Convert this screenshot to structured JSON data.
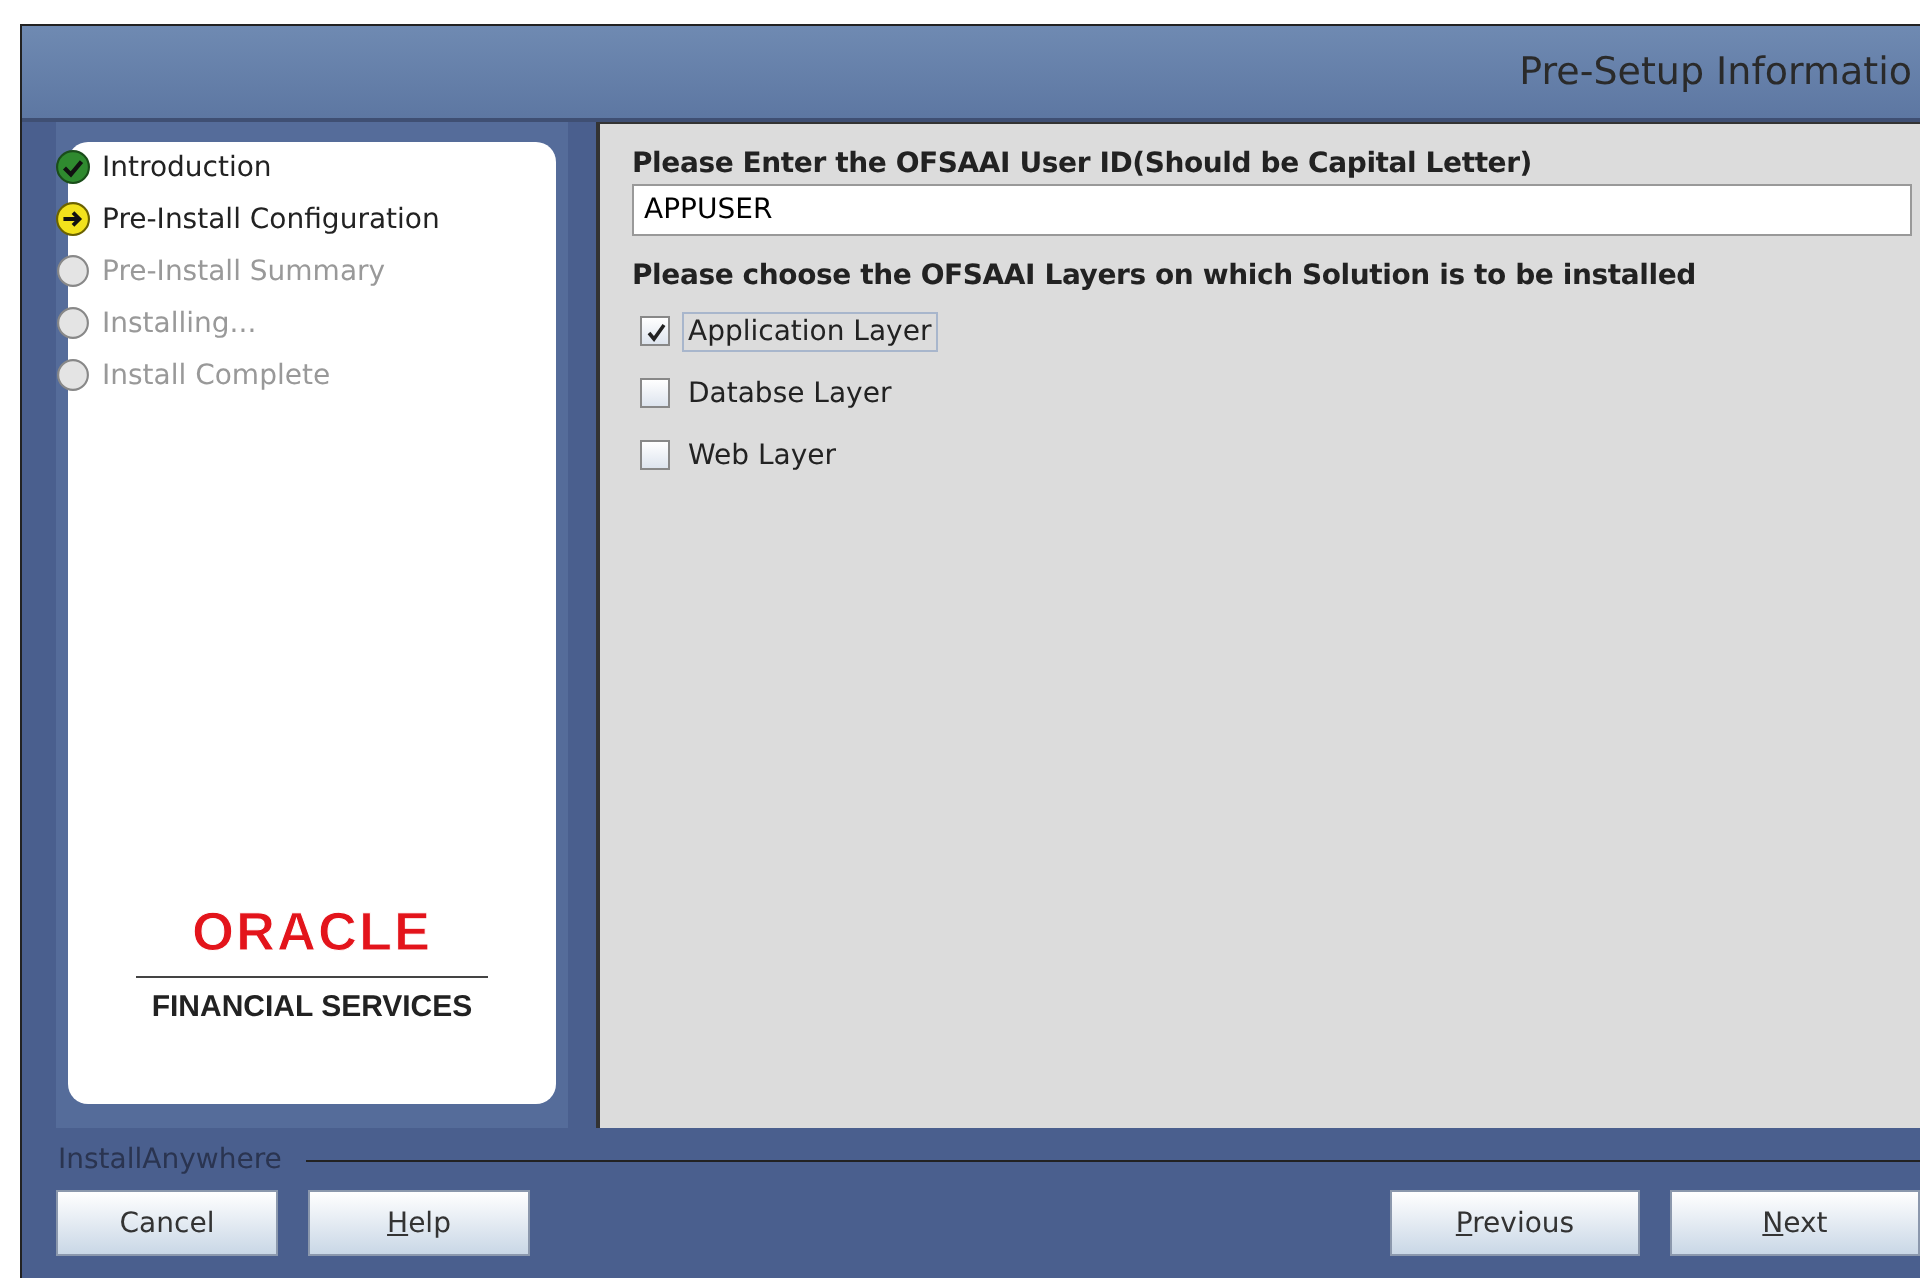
{
  "window": {
    "title": "Pre-Setup Informatio"
  },
  "steps": [
    {
      "label": "Introduction",
      "kind": "done"
    },
    {
      "label": "Pre-Install Configuration",
      "kind": "current"
    },
    {
      "label": "Pre-Install Summary",
      "kind": "pending"
    },
    {
      "label": "Installing...",
      "kind": "pending"
    },
    {
      "label": "Install Complete",
      "kind": "pending"
    }
  ],
  "logo": {
    "brand": "ORACLE",
    "subtitle": "FINANCIAL SERVICES"
  },
  "form": {
    "user_id_label": "Please Enter the OFSAAI User ID(Should be Capital Letter)",
    "user_id_value": "APPUSER",
    "layers_label": "Please choose the OFSAAI Layers on which Solution is to be installed",
    "layers": [
      {
        "label": "Application Layer",
        "checked": true
      },
      {
        "label": "Databse Layer",
        "checked": false
      },
      {
        "label": "Web Layer",
        "checked": false
      }
    ]
  },
  "footer": {
    "vendor": "InstallAnywhere"
  },
  "buttons_left": [
    {
      "label": "Cancel",
      "mnemonic": false
    },
    {
      "label": "Help",
      "mnemonic": true
    }
  ],
  "buttons_right": [
    {
      "label": "Previous",
      "mnemonic": true
    },
    {
      "label": "Next",
      "mnemonic": true
    }
  ]
}
